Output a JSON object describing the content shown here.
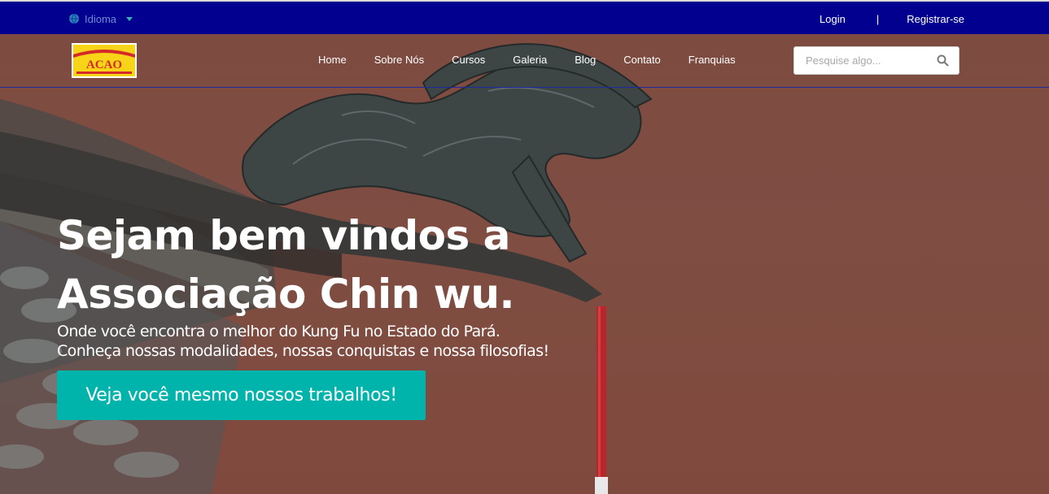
{
  "topbar": {
    "language_label": "Idioma",
    "login_label": "Login",
    "separator": "|",
    "register_label": "Registrar-se"
  },
  "logo": {
    "text": "ACAO"
  },
  "nav": {
    "items": [
      "Home",
      "Sobre Nós",
      "Cursos",
      "Galeria",
      "Blog",
      "Contato",
      "Franquias"
    ]
  },
  "search": {
    "placeholder": "Pesquise algo..."
  },
  "hero": {
    "headline_line1": "Sejam bem vindos a",
    "headline_line2": "Associação Chin wu.",
    "subtitle_line1": "Onde você encontra o melhor do Kung Fu no Estado do Pará.",
    "subtitle_line2": "Conheça nossas modalidades, nossas conquistas e nossa filosofias!",
    "cta_label": "Veja você mesmo nossos trabalhos!"
  },
  "colors": {
    "topbar": "#02008e",
    "hero_bg": "#7f4d42",
    "cta": "#00b3ab",
    "logo_red": "#d42a2a",
    "logo_yellow": "#f7d417"
  }
}
